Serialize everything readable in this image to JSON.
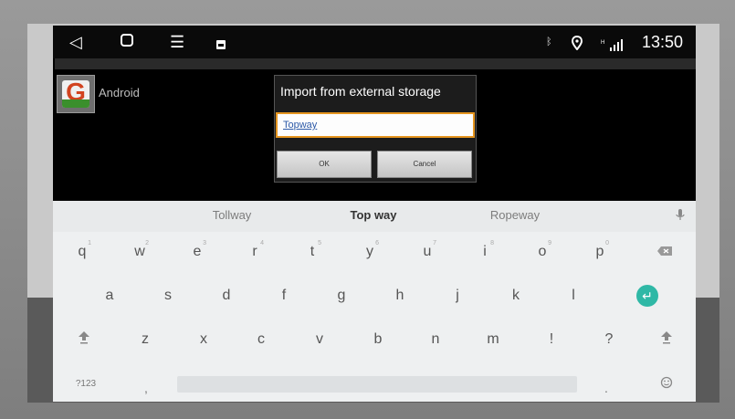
{
  "status_bar": {
    "time": "13:50",
    "nav_icons": [
      "back-icon",
      "home-icon",
      "menu-icon",
      "notification-icon"
    ],
    "status_icons": [
      "bluetooth-icon",
      "location-icon",
      "signal-icon"
    ]
  },
  "app": {
    "name": "Android"
  },
  "dialog": {
    "title": "Import from external storage",
    "input_value": "Topway",
    "ok_label": "OK",
    "cancel_label": "Cancel",
    "accent_color": "#e5951f"
  },
  "keyboard": {
    "suggestions": [
      "Tollway",
      "Top way",
      "Ropeway"
    ],
    "row1": [
      "q",
      "w",
      "e",
      "r",
      "t",
      "y",
      "u",
      "i",
      "o",
      "p"
    ],
    "row1_hints": [
      "1",
      "2",
      "3",
      "4",
      "5",
      "6",
      "7",
      "8",
      "9",
      "0"
    ],
    "row2": [
      "a",
      "s",
      "d",
      "f",
      "g",
      "h",
      "j",
      "k",
      "l"
    ],
    "row3": [
      "z",
      "x",
      "c",
      "v",
      "b",
      "n",
      "m",
      "!",
      "?"
    ],
    "symbols_label": "?123",
    "comma": ",",
    "period": ".",
    "enter_color": "#2fb8a6"
  }
}
